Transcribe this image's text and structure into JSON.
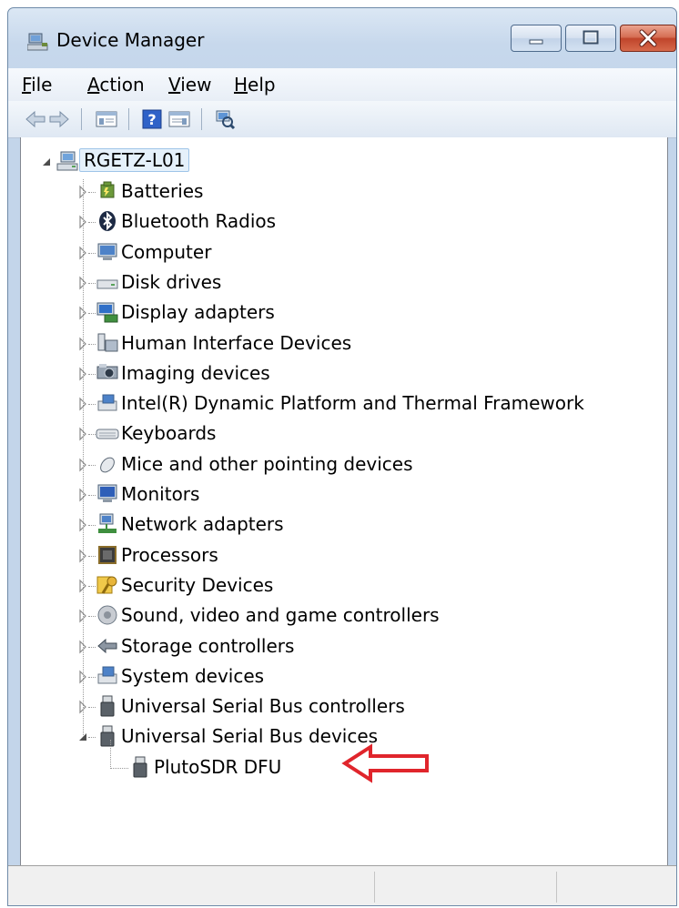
{
  "window": {
    "title": "Device Manager"
  },
  "menu": [
    {
      "accel": "F",
      "rest": "ile"
    },
    {
      "accel": "A",
      "rest": "ction"
    },
    {
      "accel": "V",
      "rest": "iew"
    },
    {
      "accel": "H",
      "rest": "elp"
    }
  ],
  "tree": {
    "root": "RGETZ-L01",
    "categories": [
      {
        "label": "Batteries",
        "icon": "battery-icon"
      },
      {
        "label": "Bluetooth Radios",
        "icon": "bluetooth-icon"
      },
      {
        "label": "Computer",
        "icon": "computer-icon"
      },
      {
        "label": "Disk drives",
        "icon": "disk-drive-icon"
      },
      {
        "label": "Display adapters",
        "icon": "display-adapter-icon"
      },
      {
        "label": "Human Interface Devices",
        "icon": "hid-icon"
      },
      {
        "label": "Imaging devices",
        "icon": "camera-icon"
      },
      {
        "label": "Intel(R) Dynamic Platform and Thermal Framework",
        "icon": "device-icon"
      },
      {
        "label": "Keyboards",
        "icon": "keyboard-icon"
      },
      {
        "label": "Mice and other pointing devices",
        "icon": "mouse-icon"
      },
      {
        "label": "Monitors",
        "icon": "monitor-icon"
      },
      {
        "label": "Network adapters",
        "icon": "network-adapter-icon"
      },
      {
        "label": "Processors",
        "icon": "processor-icon"
      },
      {
        "label": "Security Devices",
        "icon": "key-icon"
      },
      {
        "label": "Sound, video and game controllers",
        "icon": "speaker-icon"
      },
      {
        "label": "Storage controllers",
        "icon": "storage-controller-icon"
      },
      {
        "label": "System devices",
        "icon": "system-device-icon"
      },
      {
        "label": "Universal Serial Bus controllers",
        "icon": "usb-plug-icon"
      },
      {
        "label": "Universal Serial Bus devices",
        "icon": "usb-plug-icon"
      }
    ],
    "child": {
      "label": "PlutoSDR DFU",
      "icon": "usb-plug-icon"
    }
  },
  "colors": {
    "annotation_arrow": "#e0252c",
    "selection": "#e5f1fb"
  }
}
